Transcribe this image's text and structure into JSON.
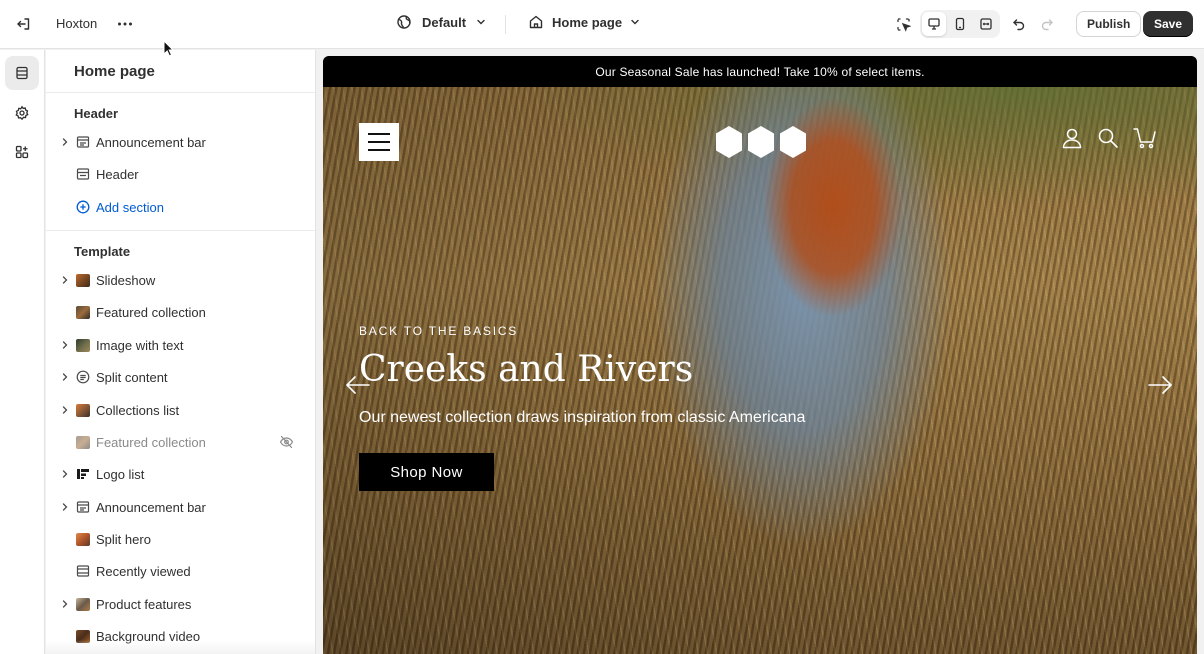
{
  "topbar": {
    "theme_name": "Hoxton",
    "theme_selector": "Default",
    "page_selector": "Home page",
    "publish_label": "Publish",
    "save_label": "Save"
  },
  "sidebar": {
    "title": "Home page",
    "header_group": {
      "title": "Header",
      "items": [
        {
          "label": "Announcement bar",
          "expandable": true,
          "icon": "announcement-bar-icon"
        },
        {
          "label": "Header",
          "expandable": false,
          "icon": "header-section-icon"
        }
      ],
      "add_section_label": "Add section"
    },
    "template_group": {
      "title": "Template",
      "items": [
        {
          "label": "Slideshow",
          "expandable": true,
          "icon": "slideshow-thumb"
        },
        {
          "label": "Featured collection",
          "expandable": false,
          "icon": "collection-thumb"
        },
        {
          "label": "Image with text",
          "expandable": true,
          "icon": "image-text-thumb"
        },
        {
          "label": "Split content",
          "expandable": true,
          "icon": "split-content-icon"
        },
        {
          "label": "Collections list",
          "expandable": true,
          "icon": "collections-thumb"
        },
        {
          "label": "Featured collection",
          "expandable": false,
          "icon": "collection-thumb",
          "hidden": true
        },
        {
          "label": "Logo list",
          "expandable": true,
          "icon": "logo-list-thumb"
        },
        {
          "label": "Announcement bar",
          "expandable": true,
          "icon": "announcement-bar-icon"
        },
        {
          "label": "Split hero",
          "expandable": false,
          "icon": "split-hero-thumb"
        },
        {
          "label": "Recently viewed",
          "expandable": false,
          "icon": "recently-viewed-icon"
        },
        {
          "label": "Product features",
          "expandable": true,
          "icon": "product-features-thumb"
        },
        {
          "label": "Background video",
          "expandable": false,
          "icon": "background-video-thumb"
        }
      ]
    }
  },
  "preview": {
    "announcement": "Our Seasonal Sale has launched! Take 10% of select items.",
    "eyebrow": "BACK TO THE BASICS",
    "title": "Creeks and Rivers",
    "subtitle": "Our newest collection draws inspiration from classic Americana",
    "cta": "Shop Now"
  },
  "colors": {
    "accent_link": "#005bd3",
    "primary_button": "#303030",
    "announcement_bg": "#000000"
  }
}
